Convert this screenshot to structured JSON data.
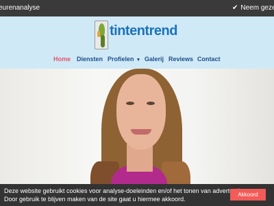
{
  "topbar": {
    "left_text": "eurenanalyse",
    "right_text": "Neem gezellig",
    "check_icon": "check-icon"
  },
  "header": {
    "brand": "tintentrend",
    "logo_icon": "tintentrend-logo-icon",
    "background": "#cfe9f6"
  },
  "nav": {
    "items": [
      {
        "label": "Home",
        "active": true
      },
      {
        "label": "Diensten"
      },
      {
        "label": "Profielen",
        "has_dropdown": true
      },
      {
        "label": "Galerij"
      },
      {
        "label": "Reviews"
      },
      {
        "label": "Contact"
      }
    ],
    "dropdown_icon": "caret-down-icon"
  },
  "hero": {
    "image": "portrait-photo"
  },
  "cookie": {
    "line1": "Deze website gebruikt cookies voor analyse-doeleinden en/of het tonen van advertenties.",
    "line2": "Door gebruik te blijven maken van de site gaat u hiermee akkoord.",
    "accept_label": "Akkoord",
    "accept_color": "#f25b58"
  },
  "colors": {
    "accent": "#e2566c",
    "nav_text": "#1f4f8a",
    "brand": "#1a73b8"
  }
}
